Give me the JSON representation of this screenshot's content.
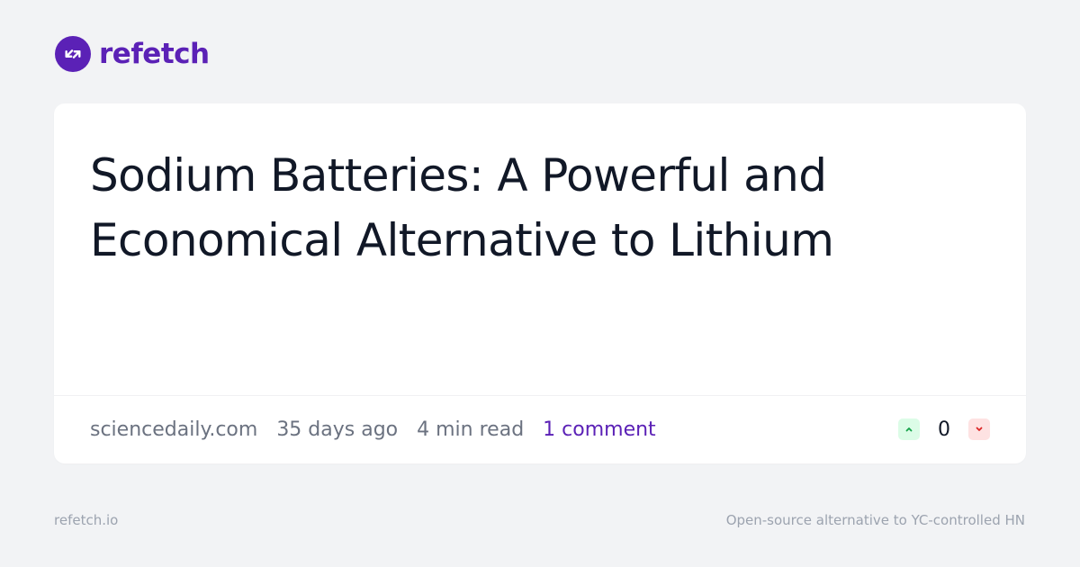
{
  "brand": {
    "name": "refetch",
    "icon": "refresh-arrows-icon",
    "color": "#5b21b6"
  },
  "post": {
    "title": "Sodium Batteries: A Powerful and Economical Alternative to Lithium",
    "domain": "sciencedaily.com",
    "age": "35 days ago",
    "read_time": "4 min read",
    "comments": "1 comment",
    "score": "0",
    "upvote_icon": "chevron-up-icon",
    "downvote_icon": "chevron-down-icon",
    "upvote_color": "#16a34a",
    "downvote_color": "#dc2626"
  },
  "footer": {
    "site": "refetch.io",
    "tagline": "Open-source alternative to YC-controlled HN"
  }
}
